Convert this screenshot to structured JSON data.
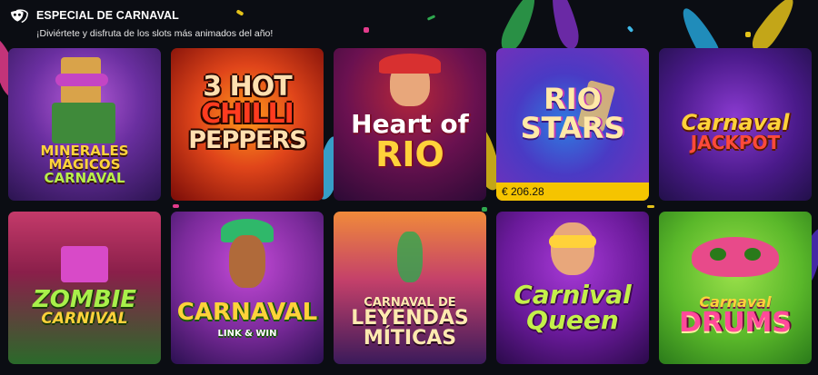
{
  "section": {
    "icon": "carnival-mask-icon",
    "title": "ESPECIAL DE CARNAVAL",
    "subtitle": "¡Diviértete y disfruta de los slots más animados del año!"
  },
  "games": [
    {
      "id": "minerales-magicos-carnaval",
      "logo_lines": [
        "MINERALES",
        "MÁGICOS",
        "CARNAVAL"
      ]
    },
    {
      "id": "3-hot-chilli-peppers",
      "logo_lines": [
        "3 HOT",
        "CHILLI",
        "PEPPERS"
      ]
    },
    {
      "id": "heart-of-rio",
      "logo_lines": [
        "Heart of",
        "RIO"
      ]
    },
    {
      "id": "rio-stars",
      "logo_lines": [
        "RIO",
        "STARS"
      ],
      "jackpot": "€ 206.28"
    },
    {
      "id": "carnaval-jackpot",
      "logo_lines": [
        "Carnaval",
        "JACKPOT"
      ]
    },
    {
      "id": "zombie-carnival",
      "logo_lines": [
        "ZOMBIE",
        "CARNIVAL"
      ]
    },
    {
      "id": "carnaval-link-win",
      "logo_lines": [
        "CARNAVAL",
        "LINK & WIN"
      ]
    },
    {
      "id": "carnaval-de-leyendas-miticas",
      "logo_lines": [
        "CARNAVAL DE",
        "LEYENDAS",
        "MÍTICAS"
      ]
    },
    {
      "id": "carnival-queen",
      "logo_lines": [
        "Carnival",
        "Queen"
      ]
    },
    {
      "id": "carnaval-drums",
      "logo_lines": [
        "Carnaval",
        "DRUMS"
      ]
    }
  ],
  "colors": {
    "accent": "#f5c400",
    "background": "#0b0d13"
  }
}
